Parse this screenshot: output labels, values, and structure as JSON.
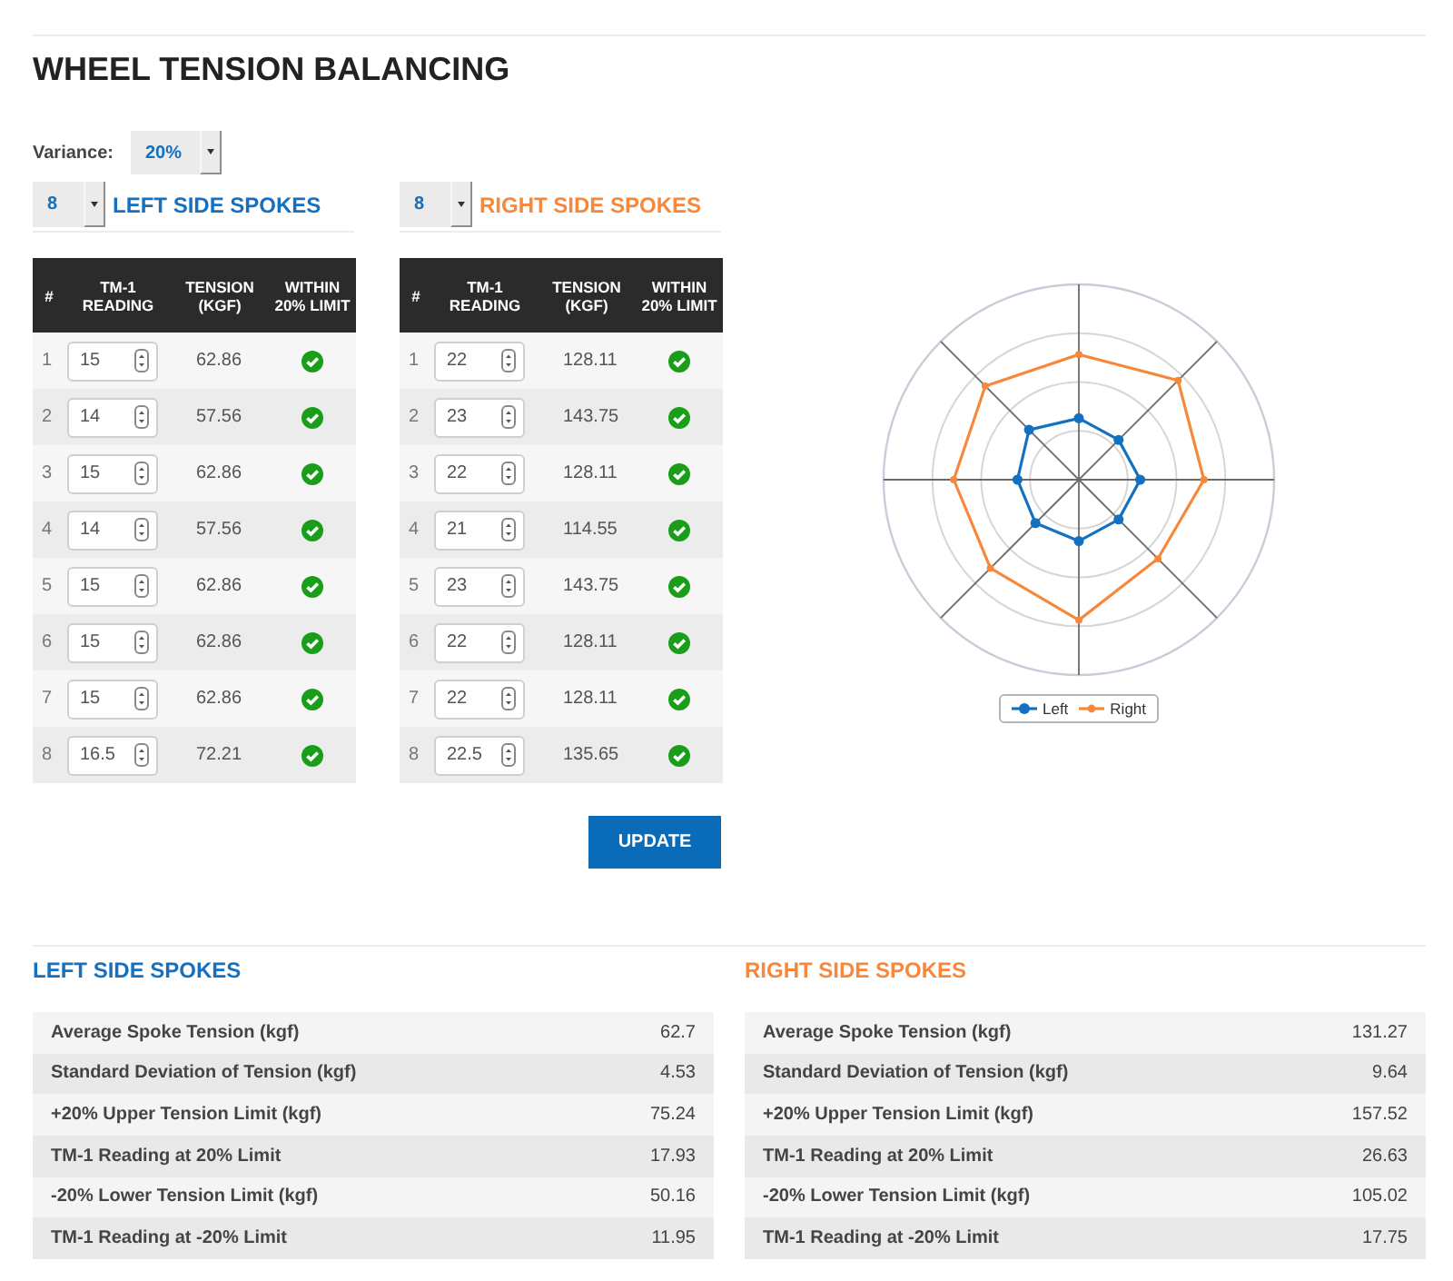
{
  "title": "WHEEL TENSION BALANCING",
  "variance": {
    "label": "Variance:",
    "value": "20%"
  },
  "sides": [
    {
      "count": "8",
      "heading": "LEFT SIDE SPOKES",
      "color": "#1470c0",
      "columns": [
        "#",
        "TM-1 READING",
        "TENSION (KGF)",
        "WITHIN 20% LIMIT"
      ],
      "rows": [
        {
          "number": "1",
          "reading": "15",
          "tension": "62.86",
          "within_limit": true
        },
        {
          "number": "2",
          "reading": "14",
          "tension": "57.56",
          "within_limit": true
        },
        {
          "number": "3",
          "reading": "15",
          "tension": "62.86",
          "within_limit": true
        },
        {
          "number": "4",
          "reading": "14",
          "tension": "57.56",
          "within_limit": true
        },
        {
          "number": "5",
          "reading": "15",
          "tension": "62.86",
          "within_limit": true
        },
        {
          "number": "6",
          "reading": "15",
          "tension": "62.86",
          "within_limit": true
        },
        {
          "number": "7",
          "reading": "15",
          "tension": "62.86",
          "within_limit": true
        },
        {
          "number": "8",
          "reading": "16.5",
          "tension": "72.21",
          "within_limit": true
        }
      ]
    },
    {
      "count": "8",
      "heading": "RIGHT SIDE SPOKES",
      "color": "#f7873a",
      "columns": [
        "#",
        "TM-1 READING",
        "TENSION (KGF)",
        "WITHIN 20% LIMIT"
      ],
      "rows": [
        {
          "number": "1",
          "reading": "22",
          "tension": "128.11",
          "within_limit": true
        },
        {
          "number": "2",
          "reading": "23",
          "tension": "143.75",
          "within_limit": true
        },
        {
          "number": "3",
          "reading": "22",
          "tension": "128.11",
          "within_limit": true
        },
        {
          "number": "4",
          "reading": "21",
          "tension": "114.55",
          "within_limit": true
        },
        {
          "number": "5",
          "reading": "23",
          "tension": "143.75",
          "within_limit": true
        },
        {
          "number": "6",
          "reading": "22",
          "tension": "128.11",
          "within_limit": true
        },
        {
          "number": "7",
          "reading": "22",
          "tension": "128.11",
          "within_limit": true
        },
        {
          "number": "8",
          "reading": "22.5",
          "tension": "135.65",
          "within_limit": true
        }
      ]
    }
  ],
  "update_button": "UPDATE",
  "chart": {
    "legend": [
      {
        "label": "Left",
        "color": "#1470c0"
      },
      {
        "label": "Right",
        "color": "#f7873a"
      }
    ]
  },
  "summaries": [
    {
      "heading": "LEFT SIDE SPOKES",
      "color": "#1470c0",
      "rows": [
        {
          "label": "Average Spoke Tension (kgf)",
          "value": "62.7"
        },
        {
          "label": "Standard Deviation of Tension (kgf)",
          "value": "4.53"
        },
        {
          "label": "+20% Upper Tension Limit (kgf)",
          "value": "75.24"
        },
        {
          "label": "TM-1 Reading at 20% Limit",
          "value": "17.93"
        },
        {
          "label": "-20% Lower Tension Limit (kgf)",
          "value": "50.16"
        },
        {
          "label": "TM-1 Reading at -20% Limit",
          "value": "11.95"
        }
      ]
    },
    {
      "heading": "RIGHT SIDE SPOKES",
      "color": "#f7873a",
      "rows": [
        {
          "label": "Average Spoke Tension (kgf)",
          "value": "131.27"
        },
        {
          "label": "Standard Deviation of Tension (kgf)",
          "value": "9.64"
        },
        {
          "label": "+20% Upper Tension Limit (kgf)",
          "value": "157.52"
        },
        {
          "label": "TM-1 Reading at 20% Limit",
          "value": "26.63"
        },
        {
          "label": "-20% Lower Tension Limit (kgf)",
          "value": "105.02"
        },
        {
          "label": "TM-1 Reading at -20% Limit",
          "value": "17.75"
        }
      ]
    }
  ]
}
